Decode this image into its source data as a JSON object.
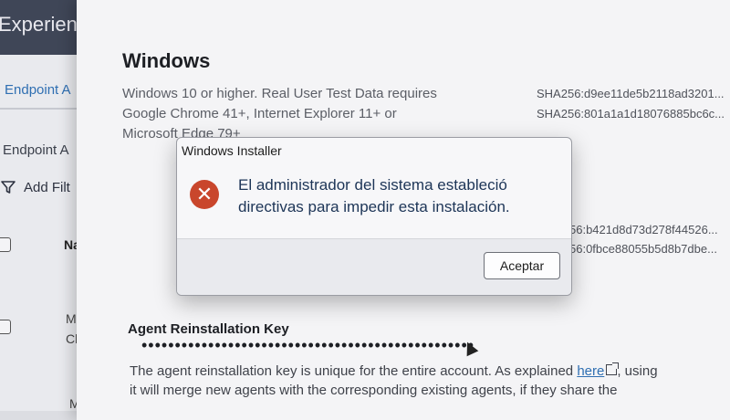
{
  "background_app": {
    "title": "Experien",
    "tab": "Endpoint A",
    "subtitle": "Endpoint A",
    "filter_label": "Add Filt",
    "column_header": "Na",
    "row1_line1": "M",
    "row1_line2": "Cl",
    "row2_line1": "M"
  },
  "windows_section": {
    "title": "Windows",
    "requirements": "Windows 10 or higher. Real User Test Data requires Google Chrome 41+, Internet Explorer 11+ or Microsoft Edge 79+",
    "hash1": "SHA256:d9ee11de5b2118ad3201...",
    "hash2": "SHA256:801a1a1d18076885bc6c...",
    "hash3": "56:b421d8d73d278f44526...",
    "hash4": "56:0fbce88055b5d8b7dbe..."
  },
  "agent_section": {
    "title": "Agent Reinstallation Key",
    "key_masked": "••••••••••••••••••••••••••••••••••••••••••••••••••",
    "explain_before": "The agent reinstallation key is unique for the entire account. As explained ",
    "explain_link": "here",
    "explain_after": ", using it will merge new agents with the corresponding existing agents, if they share the"
  },
  "dialog": {
    "title": "Windows Installer",
    "message": "El administrador del sistema estableció directivas para impedir esta instalación.",
    "icon": "error-icon",
    "accept_label": "Aceptar"
  },
  "colors": {
    "error_red": "#c9462c",
    "link_blue": "#2f6fb2",
    "topbar": "#3f4657"
  }
}
